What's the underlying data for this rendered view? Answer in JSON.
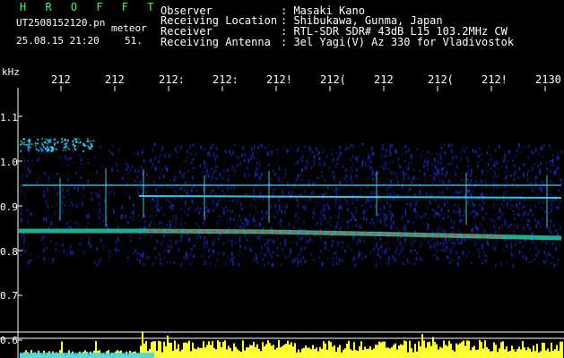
{
  "app": {
    "brand": "H R O F F T",
    "file_name": "UT2508152120.pn",
    "file_label": "meteor",
    "datetime": "25.08.15 21:20",
    "count": "51."
  },
  "header": {
    "rows": [
      {
        "label": "Observer",
        "value": ": Masaki Kano"
      },
      {
        "label": "Receiving Location",
        "value": ": Shibukawa, Gunma, Japan"
      },
      {
        "label": "Receiver",
        "value": ": RTL-SDR SDR# 43dB L15 103.2MHz CW"
      },
      {
        "label": "Receiving Antenna",
        "value": ": 3el Yagi(V) Az 330 for Vladivostok"
      }
    ]
  },
  "axis": {
    "unit": "kHz",
    "time_ticks": [
      "212",
      "212",
      "212:",
      "212:",
      "212!",
      "212(",
      "212",
      "212(",
      "212!",
      "2130"
    ],
    "freq_ticks": [
      "1.1",
      "1.0",
      "0.9",
      "0.8",
      "0.7",
      "0.6"
    ]
  },
  "colors": {
    "background": "#000000",
    "noise_blue": "#1a2ecc",
    "signal_cyan": "#33ddff",
    "signal_hot": "#ff3333",
    "amplitude_bar": "#ffff33",
    "amplitude_base": "#33ccff",
    "brand_green": "#33ff66"
  }
}
